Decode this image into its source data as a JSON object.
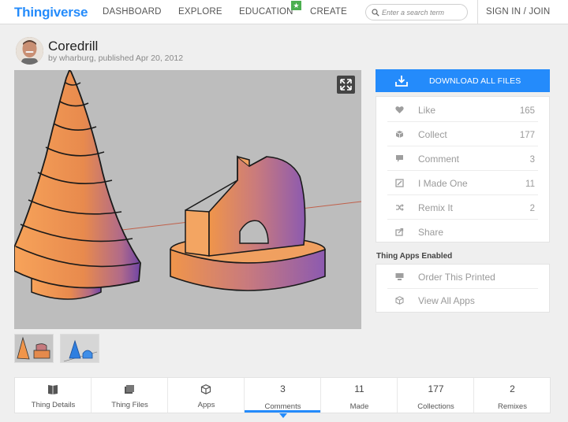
{
  "nav": {
    "logo": "Thingiverse",
    "links": [
      "DASHBOARD",
      "EXPLORE",
      "EDUCATION",
      "CREATE"
    ],
    "search_placeholder": "Enter a search term",
    "signin": "SIGN IN / JOIN"
  },
  "thing": {
    "title": "Coredrill",
    "byline": "by wharburg, published Apr 20, 2012"
  },
  "download_label": "DOWNLOAD ALL FILES",
  "actions": [
    {
      "label": "Like",
      "count": "165",
      "icon": "heart-icon"
    },
    {
      "label": "Collect",
      "count": "177",
      "icon": "collect-icon"
    },
    {
      "label": "Comment",
      "count": "3",
      "icon": "comment-icon"
    },
    {
      "label": "I Made One",
      "count": "11",
      "icon": "made-icon"
    },
    {
      "label": "Remix It",
      "count": "2",
      "icon": "remix-icon"
    },
    {
      "label": "Share",
      "count": "",
      "icon": "share-icon"
    }
  ],
  "apps_title": "Thing Apps Enabled",
  "apps": [
    {
      "label": "Order This Printed",
      "icon": "printer-icon"
    },
    {
      "label": "View All Apps",
      "icon": "cube-icon"
    }
  ],
  "tabs": [
    {
      "label": "Thing Details",
      "num": "",
      "icon": "details-icon"
    },
    {
      "label": "Thing Files",
      "num": "",
      "icon": "files-icon"
    },
    {
      "label": "Apps",
      "num": "",
      "icon": "apps-cube-icon"
    },
    {
      "label": "Comments",
      "num": "3",
      "icon": ""
    },
    {
      "label": "Made",
      "num": "11",
      "icon": ""
    },
    {
      "label": "Collections",
      "num": "177",
      "icon": ""
    },
    {
      "label": "Remixes",
      "num": "2",
      "icon": ""
    }
  ],
  "colors": {
    "accent": "#248bfb",
    "model_orange": "#f0954a",
    "model_purple": "#7b4aa8"
  }
}
